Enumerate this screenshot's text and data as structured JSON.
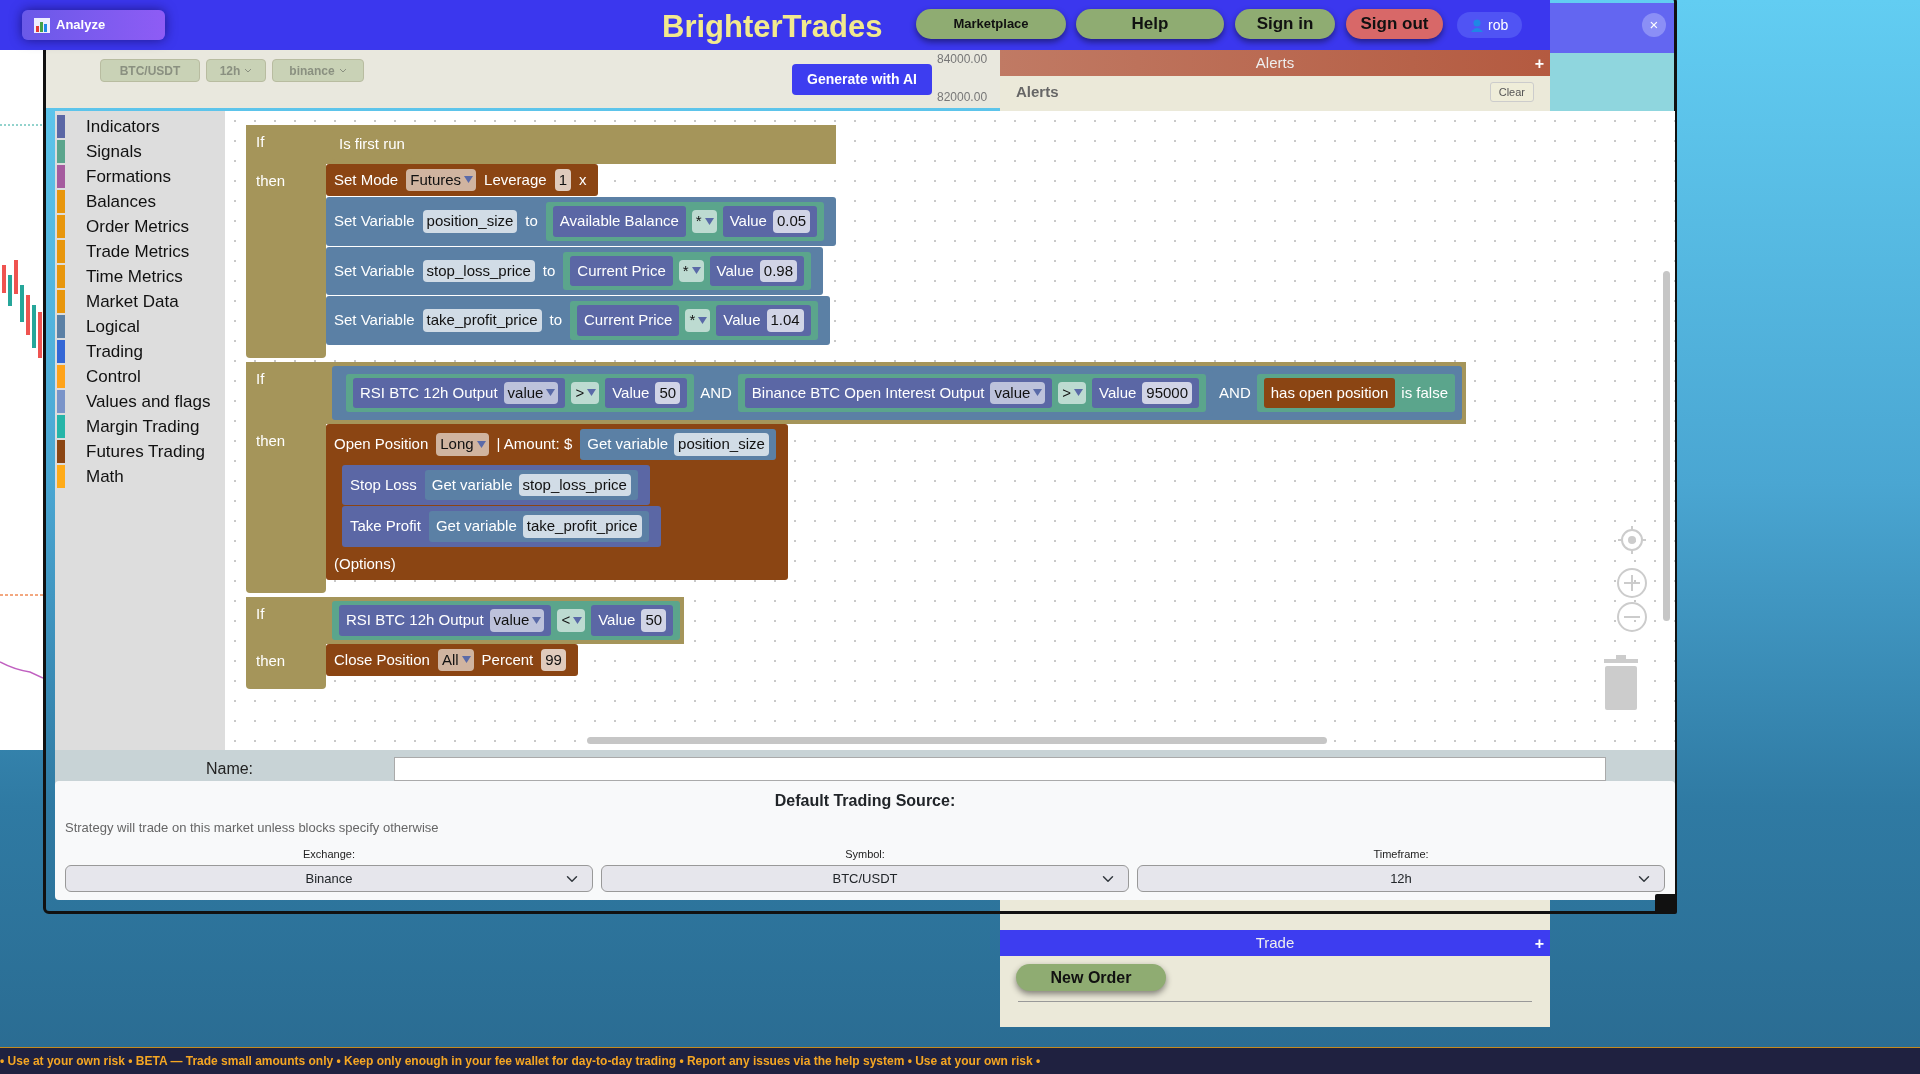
{
  "nav": {
    "analyze": "Analyze",
    "brand": "BrighterTrades",
    "buttons": [
      {
        "label": "Marketplace",
        "kind": "green"
      },
      {
        "label": "Help",
        "kind": "green"
      },
      {
        "label": "Sign in",
        "kind": "green"
      },
      {
        "label": "Sign out",
        "kind": "red"
      }
    ],
    "user": "rob"
  },
  "modal": {
    "close": "×"
  },
  "chart_toolbar": {
    "selects": [
      "BTC/USDT",
      "12h",
      "binance"
    ],
    "generate": "Generate with AI",
    "prices": [
      "84000.00",
      "82000.00"
    ]
  },
  "alerts": {
    "header": "Alerts",
    "expand": "+",
    "title": "Alerts",
    "clear": "Clear"
  },
  "trade": {
    "header": "Trade",
    "expand": "+",
    "new_order": "New Order"
  },
  "toolbox": [
    {
      "label": "Indicators",
      "color": "#5b67a5"
    },
    {
      "label": "Signals",
      "color": "#5ba58c"
    },
    {
      "label": "Formations",
      "color": "#a55b9e"
    },
    {
      "label": "Balances",
      "color": "#e8960c"
    },
    {
      "label": "Order Metrics",
      "color": "#e8960c"
    },
    {
      "label": "Trade Metrics",
      "color": "#e8960c"
    },
    {
      "label": "Time Metrics",
      "color": "#e8960c"
    },
    {
      "label": "Market Data",
      "color": "#e8960c"
    },
    {
      "label": "Logical",
      "color": "#5b80a5"
    },
    {
      "label": "Trading",
      "color": "#3467d6"
    },
    {
      "label": "Control",
      "color": "#ffa31a"
    },
    {
      "label": "Values and flags",
      "color": "#7a94c9"
    },
    {
      "label": "Margin Trading",
      "color": "#26b5a8"
    },
    {
      "label": "Futures Trading",
      "color": "#8b4513"
    },
    {
      "label": "Math",
      "color": "#ffab19"
    }
  ],
  "workspace": {
    "stack": [
      {
        "if_label": "If",
        "then_label": "then",
        "color": "#a5955a",
        "condition": {
          "color": "#a5955a",
          "parts": [
            {
              "kind": "label",
              "text": "Is first run"
            }
          ]
        },
        "statements": [
          {
            "color": "#8b4513",
            "parts": [
              {
                "kind": "label",
                "text": "Set Mode"
              },
              {
                "kind": "dropdown",
                "text": "Futures"
              },
              {
                "kind": "label",
                "text": "Leverage"
              },
              {
                "kind": "field",
                "text": "1"
              },
              {
                "kind": "label",
                "text": "x"
              }
            ]
          },
          {
            "color": "#5b80a5",
            "parts": [
              {
                "kind": "label",
                "text": "Set Variable"
              },
              {
                "kind": "field",
                "text": "position_size"
              },
              {
                "kind": "label",
                "text": "to"
              },
              {
                "kind": "block",
                "color": "#5ba58c",
                "parts": [
                  {
                    "kind": "block",
                    "color": "#5b67a5",
                    "parts": [
                      {
                        "kind": "label",
                        "text": "Available Balance"
                      }
                    ]
                  },
                  {
                    "kind": "dropdown",
                    "text": "*"
                  },
                  {
                    "kind": "block",
                    "color": "#5b67a5",
                    "parts": [
                      {
                        "kind": "label",
                        "text": "Value"
                      },
                      {
                        "kind": "field",
                        "text": "0.05"
                      }
                    ]
                  }
                ]
              }
            ]
          },
          {
            "color": "#5b80a5",
            "parts": [
              {
                "kind": "label",
                "text": "Set Variable"
              },
              {
                "kind": "field",
                "text": "stop_loss_price"
              },
              {
                "kind": "label",
                "text": "to"
              },
              {
                "kind": "block",
                "color": "#5ba58c",
                "parts": [
                  {
                    "kind": "block",
                    "color": "#5b67a5",
                    "parts": [
                      {
                        "kind": "label",
                        "text": "Current Price"
                      }
                    ]
                  },
                  {
                    "kind": "dropdown",
                    "text": "*"
                  },
                  {
                    "kind": "block",
                    "color": "#5b67a5",
                    "parts": [
                      {
                        "kind": "label",
                        "text": "Value"
                      },
                      {
                        "kind": "field",
                        "text": "0.98"
                      }
                    ]
                  }
                ]
              }
            ]
          },
          {
            "color": "#5b80a5",
            "parts": [
              {
                "kind": "label",
                "text": "Set Variable"
              },
              {
                "kind": "field",
                "text": "take_profit_price"
              },
              {
                "kind": "label",
                "text": "to"
              },
              {
                "kind": "block",
                "color": "#5ba58c",
                "parts": [
                  {
                    "kind": "block",
                    "color": "#5b67a5",
                    "parts": [
                      {
                        "kind": "label",
                        "text": "Current Price"
                      }
                    ]
                  },
                  {
                    "kind": "dropdown",
                    "text": "*"
                  },
                  {
                    "kind": "block",
                    "color": "#5b67a5",
                    "parts": [
                      {
                        "kind": "label",
                        "text": "Value"
                      },
                      {
                        "kind": "field",
                        "text": "1.04"
                      }
                    ]
                  }
                ]
              }
            ]
          }
        ]
      },
      {
        "if_label": "If",
        "then_label": "then",
        "color": "#a5955a",
        "condition": {
          "color": "#5b80a5",
          "parts": [
            {
              "kind": "block",
              "color": "#5b80a5",
              "parts": [
                {
                  "kind": "block",
                  "color": "#5ba58c",
                  "parts": [
                    {
                      "kind": "block",
                      "color": "#5b67a5",
                      "parts": [
                        {
                          "kind": "label",
                          "text": "RSI BTC 12h Output"
                        },
                        {
                          "kind": "dropdown",
                          "text": "value"
                        }
                      ]
                    },
                    {
                      "kind": "dropdown",
                      "text": ">"
                    },
                    {
                      "kind": "block",
                      "color": "#5b67a5",
                      "parts": [
                        {
                          "kind": "label",
                          "text": "Value"
                        },
                        {
                          "kind": "field",
                          "text": "50"
                        }
                      ]
                    }
                  ]
                },
                {
                  "kind": "label",
                  "text": "AND"
                },
                {
                  "kind": "block",
                  "color": "#5ba58c",
                  "parts": [
                    {
                      "kind": "block",
                      "color": "#5b67a5",
                      "parts": [
                        {
                          "kind": "label",
                          "text": "Binance BTC Open Interest Output"
                        },
                        {
                          "kind": "dropdown",
                          "text": "value"
                        }
                      ]
                    },
                    {
                      "kind": "dropdown",
                      "text": ">"
                    },
                    {
                      "kind": "block",
                      "color": "#5b67a5",
                      "parts": [
                        {
                          "kind": "label",
                          "text": "Value"
                        },
                        {
                          "kind": "field",
                          "text": "95000"
                        }
                      ]
                    }
                  ]
                }
              ]
            },
            {
              "kind": "label",
              "text": "AND"
            },
            {
              "kind": "block",
              "color": "#5ba58c",
              "parts": [
                {
                  "kind": "block",
                  "color": "#8b4513",
                  "parts": [
                    {
                      "kind": "label",
                      "text": "has open position"
                    }
                  ]
                },
                {
                  "kind": "label",
                  "text": "is false"
                }
              ]
            }
          ]
        },
        "statements": [
          {
            "color": "#8b4513",
            "parts": [
              {
                "kind": "label",
                "text": "Open Position"
              },
              {
                "kind": "dropdown",
                "text": "Long"
              },
              {
                "kind": "label",
                "text": "| Amount: $"
              },
              {
                "kind": "block",
                "color": "#5b80a5",
                "parts": [
                  {
                    "kind": "label",
                    "text": "Get variable"
                  },
                  {
                    "kind": "field",
                    "text": "position_size"
                  }
                ]
              }
            ],
            "body": [
              {
                "color": "#5b67a5",
                "parts": [
                  {
                    "kind": "label",
                    "text": "Stop Loss"
                  },
                  {
                    "kind": "block",
                    "color": "#5b80a5",
                    "parts": [
                      {
                        "kind": "label",
                        "text": "Get variable"
                      },
                      {
                        "kind": "field",
                        "text": "stop_loss_price"
                      }
                    ]
                  }
                ]
              },
              {
                "color": "#5b67a5",
                "parts": [
                  {
                    "kind": "label",
                    "text": "Take Profit"
                  },
                  {
                    "kind": "block",
                    "color": "#5b80a5",
                    "parts": [
                      {
                        "kind": "label",
                        "text": "Get variable"
                      },
                      {
                        "kind": "field",
                        "text": "take_profit_price"
                      }
                    ]
                  }
                ]
              }
            ],
            "footer": "(Options)"
          }
        ]
      },
      {
        "if_label": "If",
        "then_label": "then",
        "color": "#a5955a",
        "condition": {
          "color": "#5ba58c",
          "parts": [
            {
              "kind": "block",
              "color": "#5b67a5",
              "parts": [
                {
                  "kind": "label",
                  "text": "RSI BTC 12h Output"
                },
                {
                  "kind": "dropdown",
                  "text": "value"
                }
              ]
            },
            {
              "kind": "dropdown",
              "text": "<"
            },
            {
              "kind": "block",
              "color": "#5b67a5",
              "parts": [
                {
                  "kind": "label",
                  "text": "Value"
                },
                {
                  "kind": "field",
                  "text": "50"
                }
              ]
            }
          ]
        },
        "statements": [
          {
            "color": "#8b4513",
            "parts": [
              {
                "kind": "label",
                "text": "Close Position"
              },
              {
                "kind": "dropdown",
                "text": "All"
              },
              {
                "kind": "label",
                "text": "Percent"
              },
              {
                "kind": "field",
                "text": "99"
              }
            ]
          }
        ]
      }
    ]
  },
  "name_field": {
    "label": "Name:"
  },
  "trading_source": {
    "title": "Default Trading Source:",
    "note": "Strategy will trade on this market unless blocks specify otherwise",
    "fields": [
      {
        "label": "Exchange:",
        "value": "Binance"
      },
      {
        "label": "Symbol:",
        "value": "BTC/USDT"
      },
      {
        "label": "Timeframe:",
        "value": "12h"
      }
    ]
  },
  "ticker": "• Use at your own risk • BETA — Trade small amounts only • Keep only enough in your fee wallet for day-to-day trading • Report any issues via the help system • Use at your own risk •"
}
